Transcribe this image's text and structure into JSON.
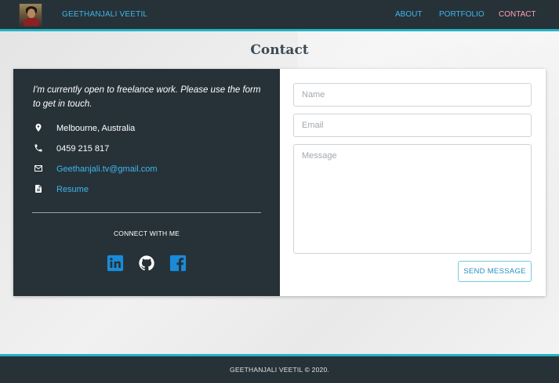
{
  "nav": {
    "brand": "GEETHANJALI VEETIL",
    "links": [
      {
        "label": "ABOUT"
      },
      {
        "label": "PORTFOLIO"
      },
      {
        "label": "CONTACT"
      }
    ]
  },
  "page_title": "Contact",
  "contact": {
    "intro": "I'm currently open to freelance work. Please use the form to get in touch.",
    "location": "Melbourne, Australia",
    "phone": "0459 215 817",
    "email": "Geethanjali.tv@gmail.com",
    "resume": "Resume",
    "connect_heading": "CONNECT WITH ME",
    "social_icons": [
      "linkedin-icon",
      "github-icon",
      "facebook-icon"
    ]
  },
  "form": {
    "name_placeholder": "Name",
    "email_placeholder": "Email",
    "message_placeholder": "Message",
    "send_label": "SEND MESSAGE"
  },
  "footer": {
    "text": "GEETHANJALI VEETIL © 2020."
  },
  "colors": {
    "nav_bg": "#263238",
    "accent_teal": "#22b3c4",
    "link_blue": "#3fb6ee",
    "active_pink": "#ff9fb4",
    "social_blue": "#1a8bd8"
  }
}
